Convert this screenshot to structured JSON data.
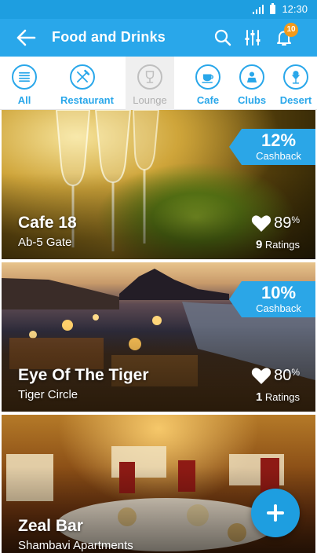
{
  "status_bar": {
    "time": "12:30",
    "icons": [
      "signal-icon",
      "battery-icon"
    ]
  },
  "app_bar": {
    "title": "Food and Drinks",
    "icons": [
      "back-arrow-icon",
      "search-icon",
      "filter-icon",
      "bell-icon"
    ],
    "notification_count": "10"
  },
  "categories": [
    {
      "label": "All",
      "icon": "list-icon",
      "active": false
    },
    {
      "label": "Restaurant",
      "icon": "fork-knife-icon",
      "active": false
    },
    {
      "label": "Lounge",
      "icon": "wine-glass-icon",
      "active": true
    },
    {
      "label": "Cafe",
      "icon": "coffee-cup-icon",
      "active": false
    },
    {
      "label": "Clubs",
      "icon": "dj-icon",
      "active": false
    },
    {
      "label": "Desert",
      "icon": "ice-cream-icon",
      "active": false
    }
  ],
  "venues": [
    {
      "name": "Cafe 18",
      "location": "Ab-5 Gate",
      "rating_percent": "89",
      "percent_sign": "%",
      "ratings_count": "9",
      "ratings_label": "Ratings",
      "cashback_percent": "12%",
      "cashback_label": "Cashback"
    },
    {
      "name": "Eye Of The Tiger",
      "location": "Tiger Circle",
      "rating_percent": "80",
      "percent_sign": "%",
      "ratings_count": "1",
      "ratings_label": "Ratings",
      "cashback_percent": "10%",
      "cashback_label": "Cashback"
    },
    {
      "name": "Zeal Bar",
      "location": "Shambavi Apartments"
    }
  ],
  "colors": {
    "primary": "#29a7ea",
    "status_bar": "#1e9ee0",
    "badge": "#f39a1a"
  }
}
